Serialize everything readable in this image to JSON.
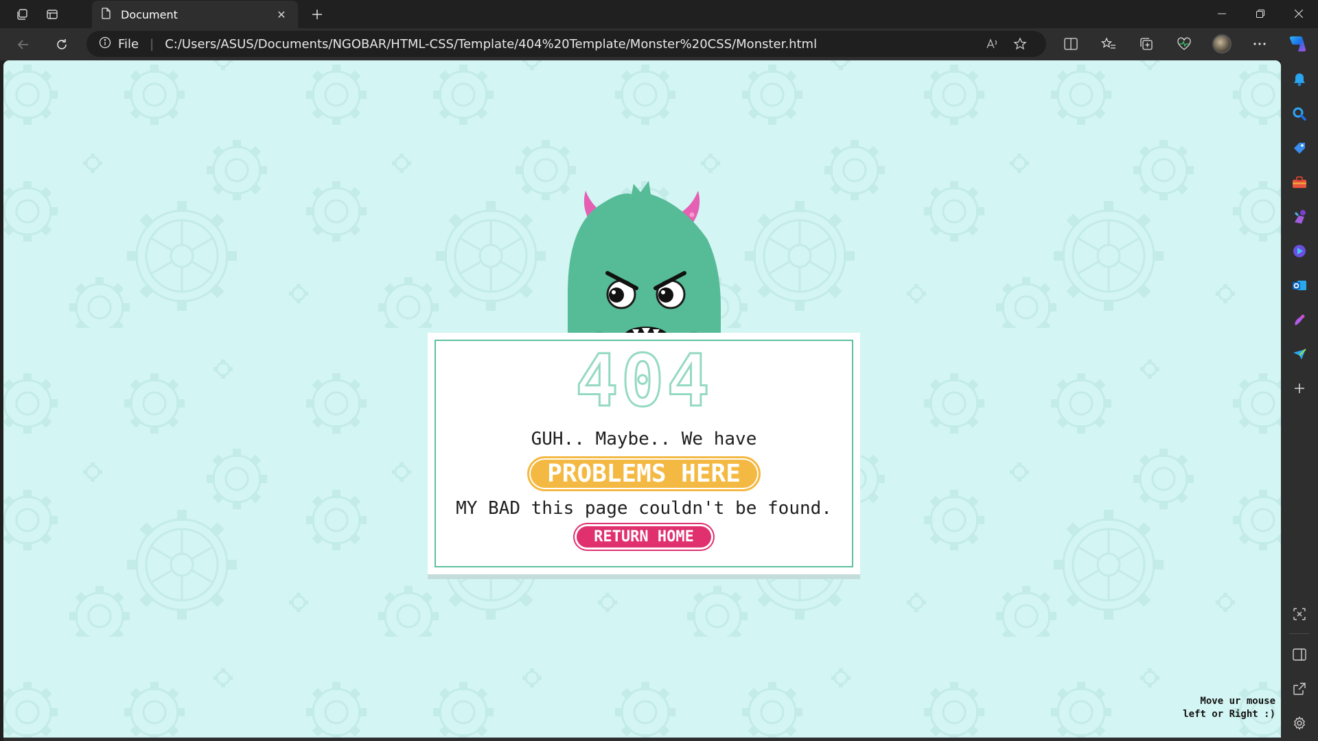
{
  "browser": {
    "tab_title": "Document",
    "address_scheme": "File",
    "address_url": "C:/Users/ASUS/Documents/NGOBAR/HTML-CSS/Template/404%20Template/Monster%20CSS/Monster.html"
  },
  "page": {
    "error_code": "404",
    "line1": "GUH.. Maybe.. We have",
    "highlight": "PROBLEMS HERE",
    "line2": "MY BAD this page couldn't be found.",
    "button": "RETURN HOME",
    "hint_line1": "Move ur mouse",
    "hint_line2": "left or Right :)"
  },
  "colors": {
    "background": "#d3f5f3",
    "monster": "#56bb97",
    "horns": "#e55fb3",
    "highlight": "#f4b942",
    "button": "#e0306d",
    "card_border": "#5cc0a0"
  },
  "icons": {
    "toolbar": [
      "read-aloud-icon",
      "favorite-star-icon",
      "split-screen-icon",
      "favorites-icon",
      "collections-icon",
      "browser-essentials-icon",
      "profile-avatar",
      "more-icon",
      "copilot-icon"
    ],
    "sidebar": [
      "notifications-icon",
      "search-icon",
      "shopping-icon",
      "tools-icon",
      "games-icon",
      "copilot-sidebar-icon",
      "outlook-icon",
      "designer-icon",
      "drop-icon",
      "add-icon"
    ]
  }
}
